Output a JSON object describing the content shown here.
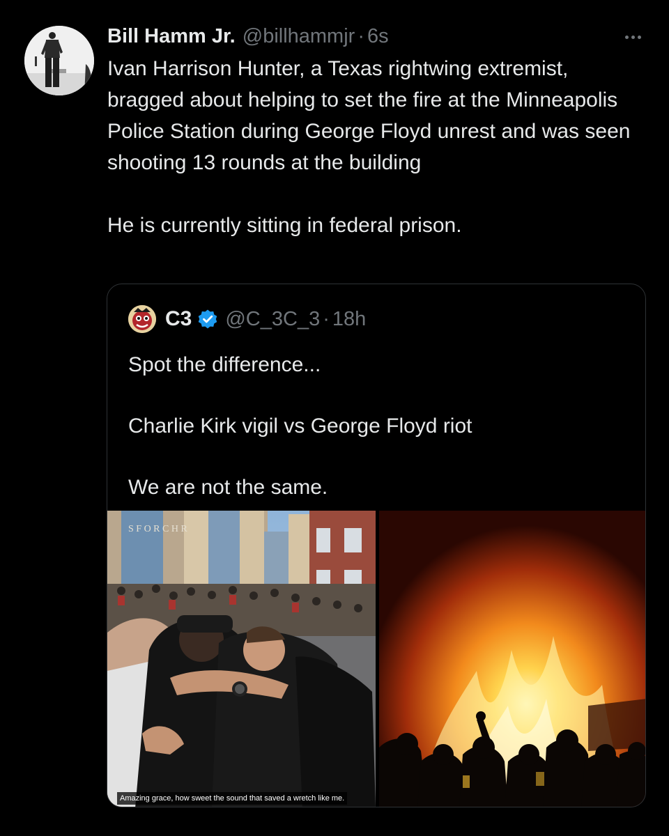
{
  "author": {
    "name": "Bill Hamm Jr.",
    "handle": "@billhammjr",
    "separator": "·",
    "time": "6s"
  },
  "more_icon": "more-horizontal-icon",
  "tweet_paragraphs": [
    "Ivan Harrison Hunter, a Texas rightwing extremist, bragged about helping to set the fire at the Minneapolis Police Station during George Floyd unrest and was seen shooting 13 rounds at the building",
    "He is currently sitting in federal prison."
  ],
  "quote": {
    "name": "C3",
    "verified": true,
    "verified_color": "#1d9bf0",
    "handle": "@C_3C_3",
    "separator": "·",
    "time": "18h",
    "paragraphs": [
      "Spot the difference...",
      "Charlie Kirk vigil vs George Floyd riot",
      "We are not the same."
    ],
    "media": {
      "left_caption": "Amazing grace, how sweet the sound that saved a wretch like me."
    }
  },
  "colors": {
    "background": "#000000",
    "text": "#e7e9ea",
    "muted": "#71767b",
    "border": "#2f3336"
  }
}
